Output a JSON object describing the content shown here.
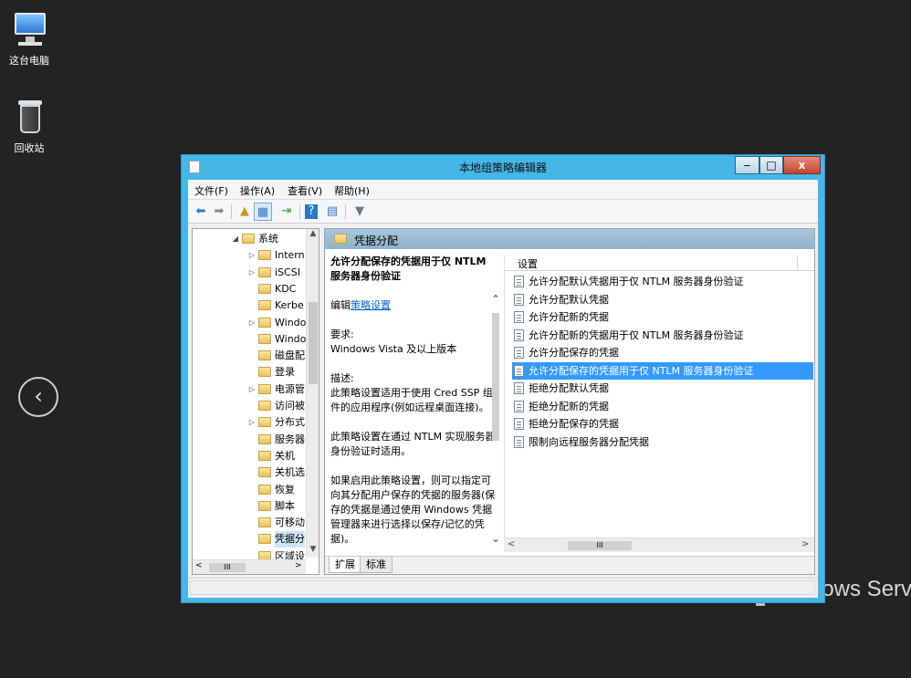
{
  "desktop": {
    "icons": [
      {
        "label": "这台电脑",
        "icon": "computer-icon"
      },
      {
        "label": "回收站",
        "icon": "recycle-bin-icon"
      }
    ],
    "nav_back_glyph": "‹",
    "background_brand_text": "lows Serv"
  },
  "window": {
    "title": "本地组策略编辑器",
    "controls": {
      "minimize": "‒",
      "maximize": "□",
      "close": "x"
    },
    "menu": [
      "文件(F)",
      "操作(A)",
      "查看(V)",
      "帮助(H)"
    ],
    "toolbar": [
      "back-arrow-icon",
      "forward-arrow-icon",
      "up-folder-icon",
      "show-hide-tree-icon",
      "export-list-icon",
      "help-icon",
      "properties-icon",
      "filter-icon"
    ]
  },
  "tree": {
    "items": [
      {
        "label": "系统",
        "expander": "◢",
        "level": 0,
        "selected": false
      },
      {
        "label": "Intern",
        "expander": "▷",
        "level": 1,
        "selected": false
      },
      {
        "label": "iSCSI",
        "expander": "▷",
        "level": 1,
        "selected": false
      },
      {
        "label": "KDC",
        "expander": "",
        "level": 1,
        "selected": false
      },
      {
        "label": "Kerbe",
        "expander": "",
        "level": 1,
        "selected": false
      },
      {
        "label": "Windo",
        "expander": "▷",
        "level": 1,
        "selected": false
      },
      {
        "label": "Windo",
        "expander": "",
        "level": 1,
        "selected": false
      },
      {
        "label": "磁盘配",
        "expander": "",
        "level": 1,
        "selected": false
      },
      {
        "label": "登录",
        "expander": "",
        "level": 1,
        "selected": false
      },
      {
        "label": "电源管",
        "expander": "▷",
        "level": 1,
        "selected": false
      },
      {
        "label": "访问被",
        "expander": "",
        "level": 1,
        "selected": false
      },
      {
        "label": "分布式",
        "expander": "▷",
        "level": 1,
        "selected": false
      },
      {
        "label": "服务器",
        "expander": "",
        "level": 1,
        "selected": false
      },
      {
        "label": "关机",
        "expander": "",
        "level": 1,
        "selected": false
      },
      {
        "label": "关机选",
        "expander": "",
        "level": 1,
        "selected": false
      },
      {
        "label": "恢复",
        "expander": "",
        "level": 1,
        "selected": false
      },
      {
        "label": "脚本",
        "expander": "",
        "level": 1,
        "selected": false
      },
      {
        "label": "可移动",
        "expander": "",
        "level": 1,
        "selected": false
      },
      {
        "label": "凭据分",
        "expander": "",
        "level": 1,
        "selected": true
      },
      {
        "label": "区域设",
        "expander": "",
        "level": 1,
        "selected": false
      }
    ],
    "hscroll_thumb": "III"
  },
  "details": {
    "header": "凭据分配",
    "policy_title": "允许分配保存的凭据用于仅 NTLM 服务器身份验证",
    "edit_prefix": "编辑",
    "edit_link": "策略设置",
    "requirements_label": "要求:",
    "requirements_value": "Windows Vista 及以上版本",
    "description_label": "描述:",
    "description_p1": "此策略设置适用于使用 Cred SSP 组件的应用程序(例如远程桌面连接)。",
    "description_p2": "此策略设置在通过 NTLM 实现服务器身份验证时适用。",
    "description_p3": "如果启用此策略设置，则可以指定可向其分配用户保存的凭据的服务器(保存的凭据是通过使用 Windows 凭据管理器来进行选择以保存/记忆的凭据)。"
  },
  "settings_list": {
    "column_header": "设置",
    "items": [
      {
        "label": "允许分配默认凭据用于仅 NTLM 服务器身份验证",
        "selected": false
      },
      {
        "label": "允许分配默认凭据",
        "selected": false
      },
      {
        "label": "允许分配新的凭据",
        "selected": false
      },
      {
        "label": "允许分配新的凭据用于仅 NTLM 服务器身份验证",
        "selected": false
      },
      {
        "label": "允许分配保存的凭据",
        "selected": false
      },
      {
        "label": "允许分配保存的凭据用于仅 NTLM 服务器身份验证",
        "selected": true
      },
      {
        "label": "拒绝分配默认凭据",
        "selected": false
      },
      {
        "label": "拒绝分配新的凭据",
        "selected": false
      },
      {
        "label": "拒绝分配保存的凭据",
        "selected": false
      },
      {
        "label": "限制向远程服务器分配凭据",
        "selected": false
      }
    ],
    "hscroll_thumb": "III"
  },
  "tabs": [
    {
      "label": "扩展",
      "active": true
    },
    {
      "label": "标准",
      "active": false
    }
  ],
  "colors": {
    "window_frame": "#45b6e6",
    "selection": "#3399ff",
    "link": "#0066cc",
    "desktop": "#232323"
  }
}
